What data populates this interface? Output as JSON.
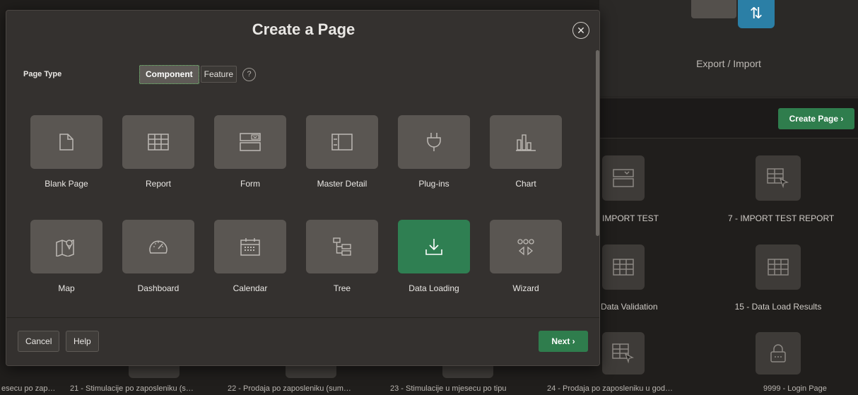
{
  "background": {
    "export_import_label": "Export / Import",
    "create_page_label": "Create Page ›",
    "cards": [
      {
        "label": "IMPORT TEST"
      },
      {
        "label": "7 - IMPORT TEST REPORT"
      },
      {
        "label": "Data Validation"
      },
      {
        "label": "15 - Data Load Results"
      }
    ],
    "bottom_labels": [
      "esecu po zap…",
      "21 - Stimulacije po zaposleniku (s…",
      "22 - Prodaja po zaposleniku (sum…",
      "23 - Stimulacije u mjesecu po tipu",
      "24 - Prodaja po zaposleniku u god…",
      "9999 - Login Page"
    ]
  },
  "dialog": {
    "title": "Create a Page",
    "close_icon": "close-icon",
    "page_type_label": "Page Type",
    "segments": {
      "component": "Component",
      "feature": "Feature",
      "selected": "Component"
    },
    "help_icon": "?",
    "tiles": [
      {
        "label": "Blank Page",
        "icon": "blank-page-icon"
      },
      {
        "label": "Report",
        "icon": "report-icon"
      },
      {
        "label": "Form",
        "icon": "form-icon"
      },
      {
        "label": "Master Detail",
        "icon": "master-detail-icon"
      },
      {
        "label": "Plug-ins",
        "icon": "plugin-icon"
      },
      {
        "label": "Chart",
        "icon": "chart-icon"
      },
      {
        "label": "Map",
        "icon": "map-icon"
      },
      {
        "label": "Dashboard",
        "icon": "dashboard-icon"
      },
      {
        "label": "Calendar",
        "icon": "calendar-icon"
      },
      {
        "label": "Tree",
        "icon": "tree-icon"
      },
      {
        "label": "Data Loading",
        "icon": "data-loading-icon",
        "selected": true
      },
      {
        "label": "Wizard",
        "icon": "wizard-icon"
      }
    ],
    "footer": {
      "cancel": "Cancel",
      "help": "Help",
      "next": "Next ›"
    }
  },
  "colors": {
    "accent_green": "#2f7f52",
    "tile_bg": "#5a5652",
    "dialog_bg": "#34312f",
    "page_bg": "#201e1c"
  }
}
